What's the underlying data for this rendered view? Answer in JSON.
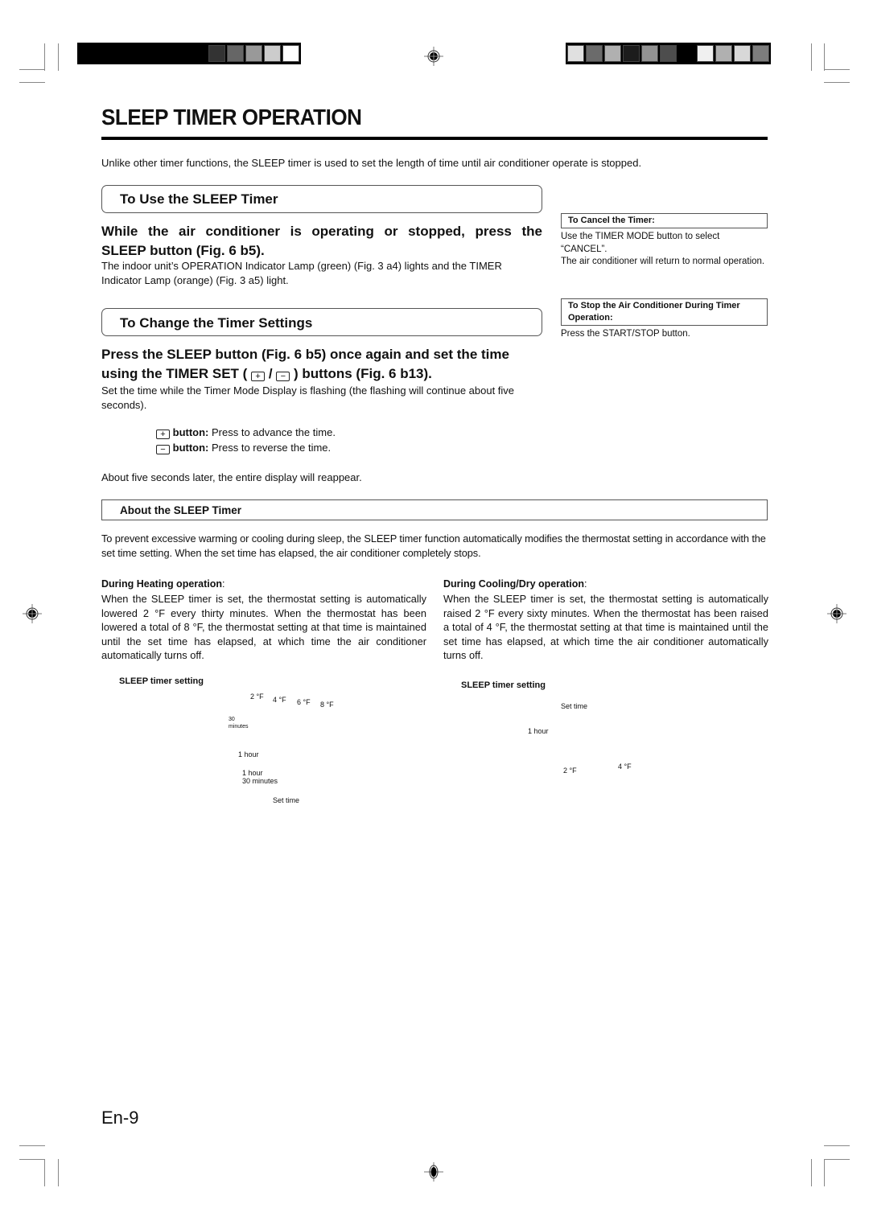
{
  "page": {
    "title": "SLEEP TIMER OPERATION",
    "intro": "Unlike other timer functions, the SLEEP timer is used to set the length of time until air conditioner operate is stopped.",
    "page_number": "En-9"
  },
  "print_marks": {
    "color_bar_left": [
      "#000000",
      "#000000",
      "#000000",
      "#000000",
      "#000000",
      "#000000",
      "#000000",
      "#333333",
      "#666666",
      "#999999",
      "#cccccc",
      "#ffffff"
    ],
    "color_bar_right": [
      "#e0e0e0",
      "#6b6b6b",
      "#b0b0b0",
      "#1c1c1c",
      "#939393",
      "#4d4d4d",
      "#000000",
      "#f0f0f0",
      "#b0b0b0",
      "#d8d8d8",
      "#7d7d7d"
    ],
    "registration_icon": "crosshair-target-icon"
  },
  "use_section": {
    "heading": "To Use the SLEEP Timer",
    "step_line1": "While the air conditioner is operating or stopped, press the",
    "step_line2": "SLEEP button (Fig. 6 b5).",
    "body": "The indoor unit’s OPERATION Indicator Lamp (green) (Fig. 3 a4) lights and the TIMER Indicator Lamp (orange) (Fig. 3 a5) light."
  },
  "sidebar": {
    "cancel_title": "To Cancel the Timer:",
    "cancel_text": "Use the TIMER MODE button to select “CANCEL”.",
    "cancel_text2": "The air conditioner will return to normal operation.",
    "stop_title": "To Stop the Air Conditioner During Timer Operation:",
    "stop_text": "Press the START/STOP button."
  },
  "change_section": {
    "heading": "To Change the Timer Settings",
    "step_line1": "Press the SLEEP button (Fig. 6 b5) once again and set the time",
    "step_line2_a": "using the TIMER SET (",
    "step_sep": "/",
    "step_line2_b": ") buttons (Fig. 6 b13).",
    "body": "Set the time while the Timer Mode Display is flashing (the flashing will continue about five seconds).",
    "plus_glyph": "+",
    "minus_glyph": "−",
    "plus_label": "button:",
    "plus_desc": "Press to advance the time.",
    "minus_label": "button:",
    "minus_desc": "Press to reverse the time.",
    "after": "About five seconds later, the entire display will reappear."
  },
  "about_section": {
    "heading": "About the SLEEP Timer",
    "body": "To prevent excessive warming or cooling during sleep, the SLEEP timer function automatically modifies the thermostat setting in accordance with the set time setting. When the set time has elapsed, the air conditioner completely stops.",
    "heating": {
      "title": "During Heating operation",
      "colon": ":",
      "body": "When the SLEEP timer is set, the thermostat setting is automatically lowered 2 °F every thirty minutes. When the thermostat has been lowered a total of 8 °F, the thermostat setting at that time is maintained until the set time has elapsed, at which time the air conditioner automatically turns off."
    },
    "cooling": {
      "title": "During Cooling/Dry operation",
      "colon": ":",
      "body": "When the SLEEP timer is set, the thermostat setting is automatically raised 2 °F every sixty minutes. When the thermostat has been raised a total of 4 °F, the thermostat setting at that time is maintained until the set time has elapsed, at which time the air conditioner automatically turns off."
    }
  },
  "figures": {
    "heating": {
      "title": "SLEEP timer setting",
      "temps": [
        "2 °F",
        "4 °F",
        "6 °F",
        "8 °F"
      ],
      "t30_a": "30",
      "t30_b": "minutes",
      "t60": "1 hour",
      "t90_a": "1 hour",
      "t90_b": "30 minutes",
      "set_time": "Set time"
    },
    "cooling": {
      "title": "SLEEP timer setting",
      "set_time": "Set time",
      "t60": "1 hour",
      "temps": [
        "2 °F",
        "4 °F"
      ]
    }
  }
}
